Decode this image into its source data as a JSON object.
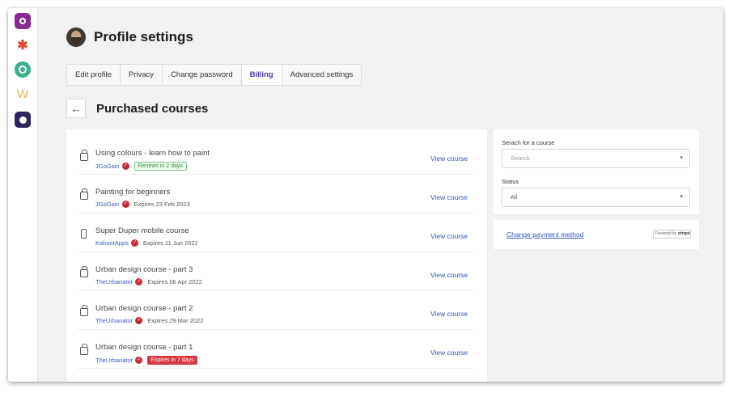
{
  "sidebar": {
    "apps": [
      {
        "icon": "app-logo-icon"
      },
      {
        "icon": "pinwheel-icon",
        "glyph": "✱"
      },
      {
        "icon": "chat-bubble-icon"
      },
      {
        "icon": "w-logo-icon",
        "glyph": "W"
      },
      {
        "icon": "monster-icon"
      }
    ]
  },
  "header": {
    "title": "Profile settings"
  },
  "tabs": [
    {
      "label": "Edit profile"
    },
    {
      "label": "Privacy"
    },
    {
      "label": "Change password"
    },
    {
      "label": "Billing",
      "active": true
    },
    {
      "label": "Advanced settings"
    }
  ],
  "subheader": {
    "back_glyph": "←",
    "title": "Purchased courses"
  },
  "courses": [
    {
      "title": "Using colours - learn how to paint",
      "author": "JGoGain",
      "status": "Renews in 2 days",
      "status_kind": "green",
      "icon": "bag-icon",
      "link": "View course"
    },
    {
      "title": "Painting for beginners",
      "author": "JGoGain",
      "status": "Expires 23 Feb 2023",
      "status_kind": "plain",
      "icon": "bag-icon",
      "link": "View course"
    },
    {
      "title": "Super Duper mobile course",
      "author": "KahootApps",
      "status": "Expires 11 Jun 2022",
      "status_kind": "plain",
      "icon": "phone-icon",
      "link": "View course"
    },
    {
      "title": "Urban design course - part 3",
      "author": "TheUrbanator",
      "status": "Expires 06 Apr 2022",
      "status_kind": "plain",
      "icon": "bag-icon",
      "link": "View course"
    },
    {
      "title": "Urban design course - part 2",
      "author": "TheUrbanator",
      "status": "Expires 29 Mar 2022",
      "status_kind": "plain",
      "icon": "bag-icon",
      "link": "View course"
    },
    {
      "title": "Urban design course - part 1",
      "author": "TheUrbanator",
      "status": "Expires in 7 days",
      "status_kind": "red",
      "icon": "bag-icon",
      "link": "View course"
    }
  ],
  "filters": {
    "search_label": "Serach for a course",
    "search_placeholder": "Search",
    "status_label": "Status",
    "status_value": "All"
  },
  "payment": {
    "link": "Change payment method",
    "badge_prefix": "Powered by",
    "badge_brand": "stripe"
  },
  "colors": {
    "accent": "#4a3aa8",
    "link": "#2f55c4",
    "danger": "#d93644",
    "success": "#2e8b3a"
  }
}
